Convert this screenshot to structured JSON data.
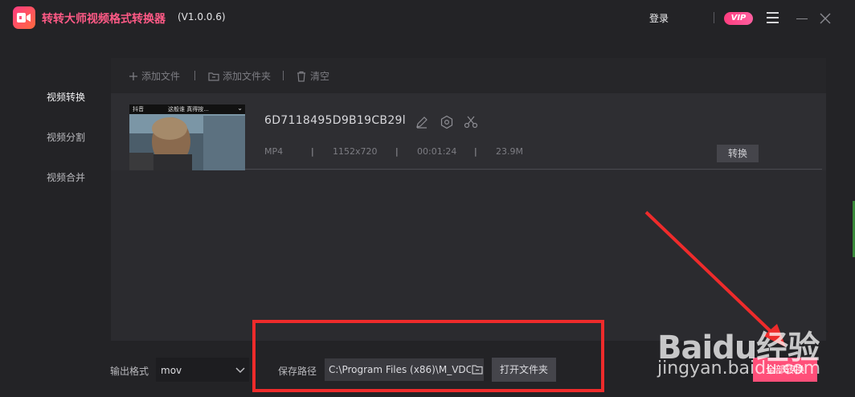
{
  "app": {
    "title": "转转大师视频格式转换器",
    "version": "(V1.0.0.6)",
    "login": "登录",
    "vip": "VIP"
  },
  "sidebar": {
    "items": [
      {
        "label": "视频转换",
        "active": true
      },
      {
        "label": "视频分割",
        "active": false
      },
      {
        "label": "视频合并",
        "active": false
      }
    ]
  },
  "toolbar": {
    "add_file": "添加文件",
    "add_folder": "添加文件夹",
    "clear": "清空"
  },
  "file": {
    "name": "6D7118495D9B19CB29l",
    "format": "MP4",
    "resolution": "1152x720",
    "duration": "00:01:24",
    "size": "23.9M",
    "convert": "转换",
    "thumb_caption": "这般谁 真得按...",
    "thumb_tag": "抖音"
  },
  "bottom": {
    "output_format_label": "输出格式",
    "output_format_value": "mov",
    "save_path_label": "保存路径",
    "save_path_value": "C:\\Program Files (x86)\\M_VDC",
    "open_folder": "打开文件夹",
    "start": "全部转换"
  },
  "watermark": {
    "main": "Baidu经验",
    "sub": "jingyan.baidu.com"
  },
  "colors": {
    "accent": "#ff4f79",
    "annotation": "#ee2b2b",
    "background": "#232326"
  }
}
